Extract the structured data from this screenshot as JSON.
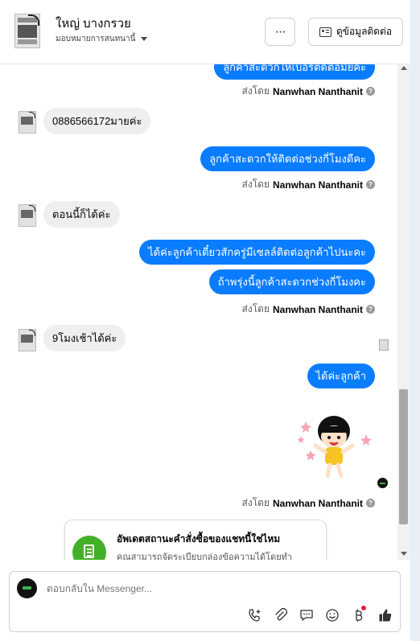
{
  "header": {
    "name": "ใหญ่ บางกรวย",
    "assign_label": "มอบหมายการสนทนานี้",
    "more_label": "···",
    "contact_label": "ดูข้อมูลติดต่อ"
  },
  "thread": {
    "top_partial_out": "ลูกค้าสะดวกให้เบอร์ติดต่อมั้ยคะ",
    "sent_by_prefix": "ส่งโดย",
    "sender": "Nanwhan Nanthanit",
    "in_msg_1": "0886566172มายค่ะ",
    "out_msg_1": "ลูกค้าสะดวกให้ติดต่อช่วงกี่โมงดีคะ",
    "in_msg_2": "ตอนนี้ก็ได้ค่ะ",
    "out_msg_2a": "ได้ค่ะลูกค้าเดี๋ยวสักครู่มีเซลล์ติดต่อลูกค้าไปนะคะ",
    "out_msg_2b": "ถ้าพรุ่งนี้ลูกค้าสะดวกช่วงกี่โมงคะ",
    "in_msg_3": "9โมงเช้าได้ค่ะ",
    "out_msg_3": "ได้ค่ะลูกค้า"
  },
  "card": {
    "title": "อัพเดตสถานะคำสั่งซื้อของแชทนี้ใช่ไหม",
    "text": "คุณสามารถจัดระเบียบกล่องข้อความได้โดยทำ"
  },
  "composer": {
    "placeholder": "ตอบกลับใน Messenger..."
  },
  "icons": {
    "more": "more-dots-icon",
    "contact": "contact-card-icon",
    "info": "info-icon",
    "call": "call-add-icon",
    "attach": "paperclip-icon",
    "saved_replies": "chat-bubble-icon",
    "emoji": "smiley-icon",
    "payment": "baht-icon",
    "like": "thumbs-up-icon"
  },
  "colors": {
    "outgoing_bubble": "#0a7cff",
    "incoming_bubble": "#efefef",
    "card_icon": "#43b02a",
    "notification_dot": "#e41e3f"
  }
}
